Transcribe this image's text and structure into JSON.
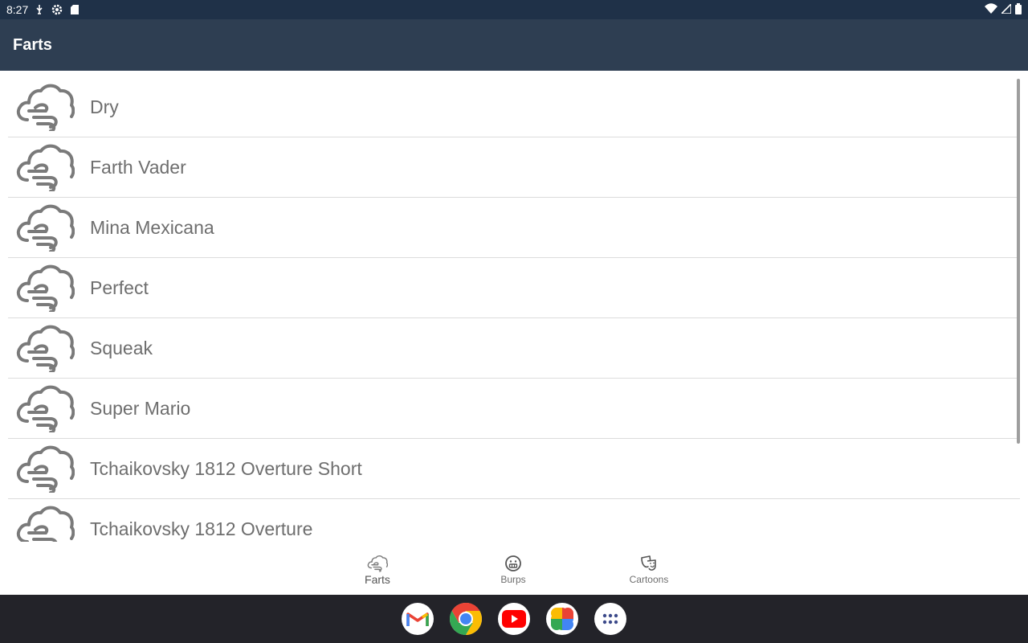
{
  "status_bar": {
    "time": "8:27",
    "left_icons": [
      "usb-debug-icon",
      "settings-icon",
      "sd-card-icon"
    ],
    "right_icons": [
      "wifi-icon",
      "signal-icon",
      "battery-icon"
    ]
  },
  "app_bar": {
    "title": "Farts"
  },
  "list": {
    "icon": "fart-cloud-icon",
    "items": [
      {
        "label": "Dry"
      },
      {
        "label": "Farth Vader"
      },
      {
        "label": "Mina Mexicana"
      },
      {
        "label": "Perfect"
      },
      {
        "label": "Squeak"
      },
      {
        "label": "Super Mario"
      },
      {
        "label": "Tchaikovsky 1812 Overture Short"
      },
      {
        "label": "Tchaikovsky 1812 Overture"
      }
    ]
  },
  "bottom_nav": {
    "active": "Farts",
    "items": [
      {
        "label": "Farts",
        "icon": "fart-cloud-icon"
      },
      {
        "label": "Burps",
        "icon": "burp-face-icon"
      },
      {
        "label": "Cartoons",
        "icon": "theater-masks-icon"
      }
    ]
  },
  "dock": {
    "apps": [
      {
        "name": "Gmail",
        "icon": "gmail-icon"
      },
      {
        "name": "Chrome",
        "icon": "chrome-icon"
      },
      {
        "name": "YouTube",
        "icon": "youtube-icon"
      },
      {
        "name": "Photos",
        "icon": "photos-icon"
      },
      {
        "name": "App drawer",
        "icon": "app-drawer-icon"
      }
    ]
  },
  "colors": {
    "status_bar": "#1f3148",
    "app_bar": "#2e3e52",
    "icon_gray": "#7a7a7a",
    "label_gray": "#6e6e6e",
    "dock": "#232329"
  }
}
